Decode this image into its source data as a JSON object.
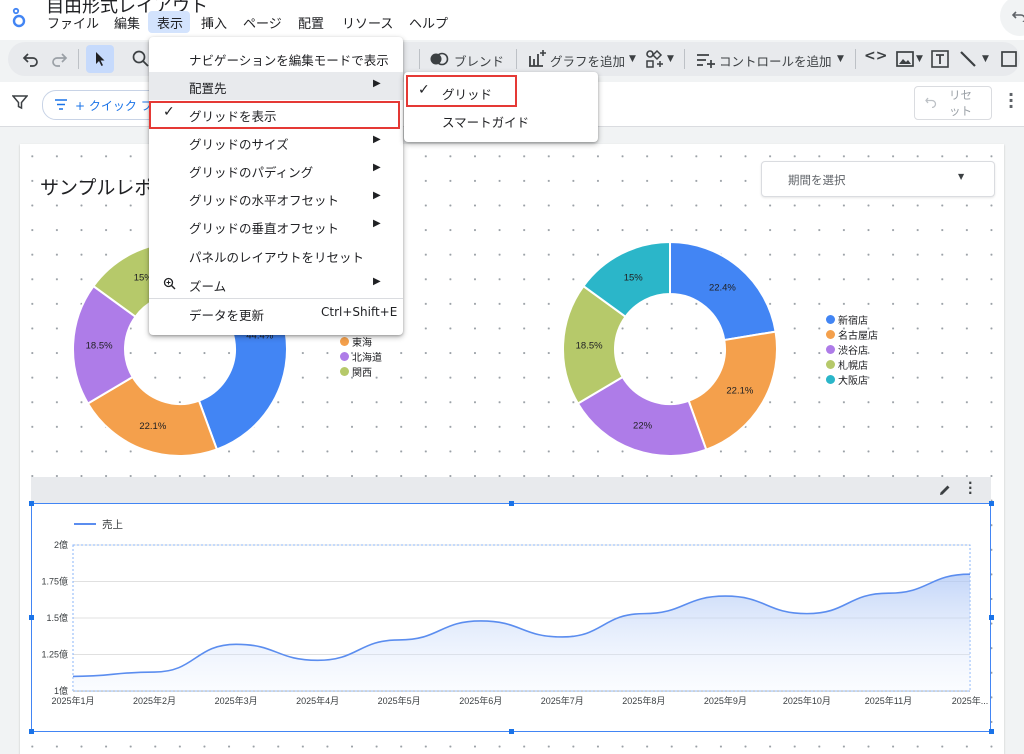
{
  "app": {
    "doc_title": "自由形式レイアウト",
    "menus": [
      "ファイル",
      "編集",
      "表示",
      "挿入",
      "ページ",
      "配置",
      "リソース",
      "ヘルプ"
    ]
  },
  "toolbar": {
    "blend_label": "ブレンド",
    "add_chart_label": "グラフを追加",
    "add_control_label": "コントロールを追加"
  },
  "filterbar": {
    "quick_filter_label": "+ クイック フ",
    "reset_label_1": "リセ",
    "reset_label_2": "ット"
  },
  "report": {
    "title": "サンプルレポ",
    "date_picker_placeholder": "期間を選択"
  },
  "view_menu": {
    "items": [
      {
        "label": "ナビゲーションを編集モードで表示"
      },
      {
        "label": "配置先",
        "submenu": true
      },
      {
        "label": "グリッドを表示",
        "checked": true
      },
      {
        "label": "グリッドのサイズ",
        "submenu": true
      },
      {
        "label": "グリッドのパディング",
        "submenu": true
      },
      {
        "label": "グリッドの水平オフセット",
        "submenu": true
      },
      {
        "label": "グリッドの垂直オフセット",
        "submenu": true
      },
      {
        "label": "パネルのレイアウトをリセット"
      },
      {
        "label": "ズーム",
        "submenu": true
      },
      {
        "label": "データを更新",
        "shortcut": "Ctrl+Shift+E"
      }
    ]
  },
  "arrange_submenu": {
    "items": [
      {
        "label": "グリッド",
        "checked": true
      },
      {
        "label": "スマートガイド"
      }
    ]
  },
  "chart_data": [
    {
      "type": "pie",
      "labels": [
        "新宿店",
        "名古屋店",
        "渋谷店",
        "札幌店",
        "大阪店"
      ],
      "values": [
        22.4,
        22.1,
        22,
        18.5,
        15
      ],
      "colors": [
        "#4285f4",
        "#f4a04c",
        "#ae7ce8",
        "#b6c96a",
        "#2bb6c9"
      ],
      "slice_labels": [
        "22.4%",
        "22.1%",
        "22%",
        "18.5%",
        "15%"
      ]
    },
    {
      "type": "pie",
      "legend_visible": [
        "東海",
        "北海道",
        "関西"
      ],
      "legend_colors": [
        "#f4a04c",
        "#ae7ce8",
        "#b6c96a"
      ],
      "values": [
        44.4,
        22.1,
        18.5,
        15
      ],
      "colors": [
        "#4285f4",
        "#f4a04c",
        "#ae7ce8",
        "#b6c96a"
      ],
      "slice_labels": [
        "44.4%",
        "22.1%",
        "18.5%",
        "15%"
      ]
    },
    {
      "type": "area",
      "series": [
        {
          "name": "売上",
          "color": "#5b8def"
        }
      ],
      "x": [
        "2025年1月",
        "2025年2月",
        "2025年3月",
        "2025年4月",
        "2025年5月",
        "2025年6月",
        "2025年7月",
        "2025年8月",
        "2025年9月",
        "2025年10月",
        "2025年11月",
        "2025年..."
      ],
      "values": [
        1.1,
        1.13,
        1.32,
        1.21,
        1.35,
        1.48,
        1.37,
        1.53,
        1.65,
        1.53,
        1.67,
        1.8
      ],
      "y_ticks": [
        "1億",
        "1.25億",
        "1.5億",
        "1.75億",
        "2億"
      ],
      "ylim": [
        1,
        2
      ]
    }
  ]
}
